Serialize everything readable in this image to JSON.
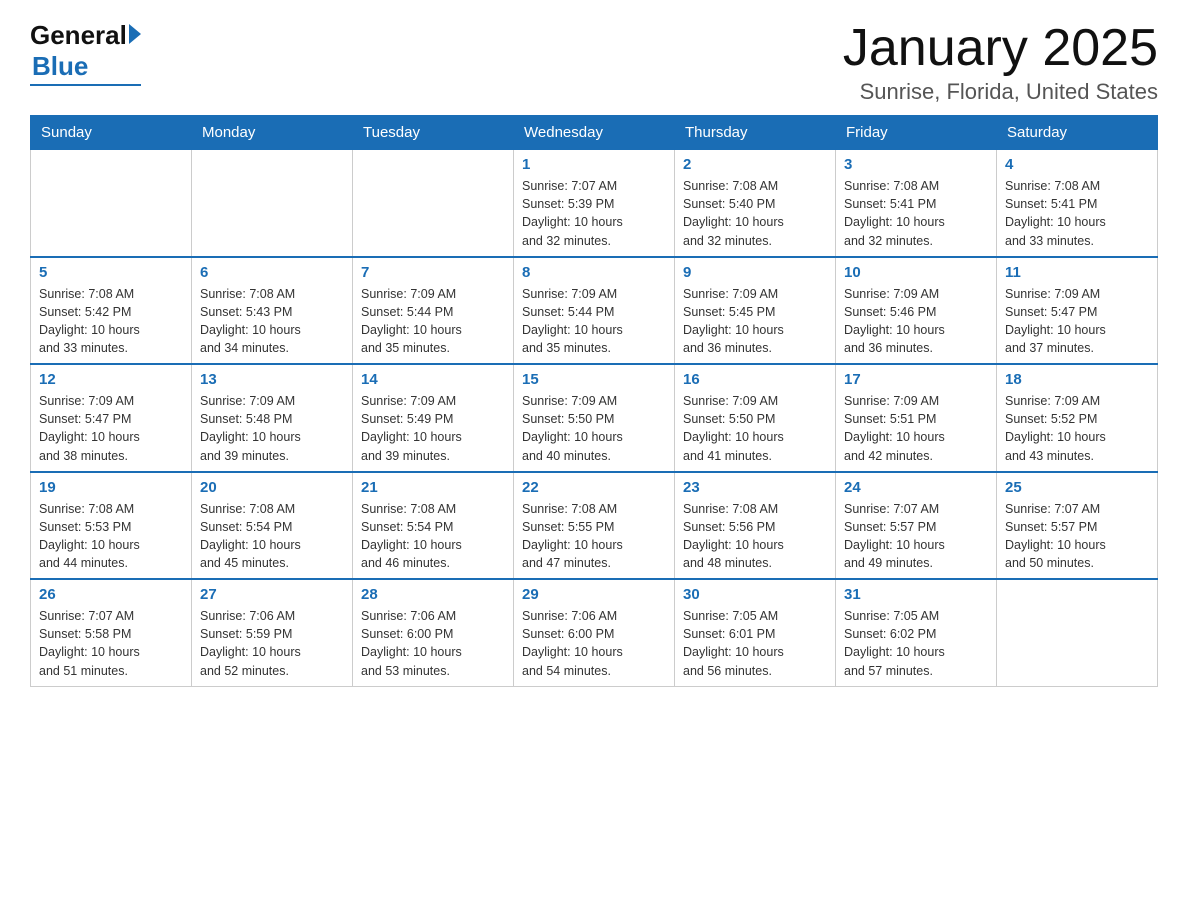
{
  "header": {
    "logo_general": "General",
    "logo_blue": "Blue",
    "title": "January 2025",
    "location": "Sunrise, Florida, United States"
  },
  "days_of_week": [
    "Sunday",
    "Monday",
    "Tuesday",
    "Wednesday",
    "Thursday",
    "Friday",
    "Saturday"
  ],
  "weeks": [
    {
      "days": [
        {
          "number": "",
          "info": ""
        },
        {
          "number": "",
          "info": ""
        },
        {
          "number": "",
          "info": ""
        },
        {
          "number": "1",
          "info": "Sunrise: 7:07 AM\nSunset: 5:39 PM\nDaylight: 10 hours\nand 32 minutes."
        },
        {
          "number": "2",
          "info": "Sunrise: 7:08 AM\nSunset: 5:40 PM\nDaylight: 10 hours\nand 32 minutes."
        },
        {
          "number": "3",
          "info": "Sunrise: 7:08 AM\nSunset: 5:41 PM\nDaylight: 10 hours\nand 32 minutes."
        },
        {
          "number": "4",
          "info": "Sunrise: 7:08 AM\nSunset: 5:41 PM\nDaylight: 10 hours\nand 33 minutes."
        }
      ]
    },
    {
      "days": [
        {
          "number": "5",
          "info": "Sunrise: 7:08 AM\nSunset: 5:42 PM\nDaylight: 10 hours\nand 33 minutes."
        },
        {
          "number": "6",
          "info": "Sunrise: 7:08 AM\nSunset: 5:43 PM\nDaylight: 10 hours\nand 34 minutes."
        },
        {
          "number": "7",
          "info": "Sunrise: 7:09 AM\nSunset: 5:44 PM\nDaylight: 10 hours\nand 35 minutes."
        },
        {
          "number": "8",
          "info": "Sunrise: 7:09 AM\nSunset: 5:44 PM\nDaylight: 10 hours\nand 35 minutes."
        },
        {
          "number": "9",
          "info": "Sunrise: 7:09 AM\nSunset: 5:45 PM\nDaylight: 10 hours\nand 36 minutes."
        },
        {
          "number": "10",
          "info": "Sunrise: 7:09 AM\nSunset: 5:46 PM\nDaylight: 10 hours\nand 36 minutes."
        },
        {
          "number": "11",
          "info": "Sunrise: 7:09 AM\nSunset: 5:47 PM\nDaylight: 10 hours\nand 37 minutes."
        }
      ]
    },
    {
      "days": [
        {
          "number": "12",
          "info": "Sunrise: 7:09 AM\nSunset: 5:47 PM\nDaylight: 10 hours\nand 38 minutes."
        },
        {
          "number": "13",
          "info": "Sunrise: 7:09 AM\nSunset: 5:48 PM\nDaylight: 10 hours\nand 39 minutes."
        },
        {
          "number": "14",
          "info": "Sunrise: 7:09 AM\nSunset: 5:49 PM\nDaylight: 10 hours\nand 39 minutes."
        },
        {
          "number": "15",
          "info": "Sunrise: 7:09 AM\nSunset: 5:50 PM\nDaylight: 10 hours\nand 40 minutes."
        },
        {
          "number": "16",
          "info": "Sunrise: 7:09 AM\nSunset: 5:50 PM\nDaylight: 10 hours\nand 41 minutes."
        },
        {
          "number": "17",
          "info": "Sunrise: 7:09 AM\nSunset: 5:51 PM\nDaylight: 10 hours\nand 42 minutes."
        },
        {
          "number": "18",
          "info": "Sunrise: 7:09 AM\nSunset: 5:52 PM\nDaylight: 10 hours\nand 43 minutes."
        }
      ]
    },
    {
      "days": [
        {
          "number": "19",
          "info": "Sunrise: 7:08 AM\nSunset: 5:53 PM\nDaylight: 10 hours\nand 44 minutes."
        },
        {
          "number": "20",
          "info": "Sunrise: 7:08 AM\nSunset: 5:54 PM\nDaylight: 10 hours\nand 45 minutes."
        },
        {
          "number": "21",
          "info": "Sunrise: 7:08 AM\nSunset: 5:54 PM\nDaylight: 10 hours\nand 46 minutes."
        },
        {
          "number": "22",
          "info": "Sunrise: 7:08 AM\nSunset: 5:55 PM\nDaylight: 10 hours\nand 47 minutes."
        },
        {
          "number": "23",
          "info": "Sunrise: 7:08 AM\nSunset: 5:56 PM\nDaylight: 10 hours\nand 48 minutes."
        },
        {
          "number": "24",
          "info": "Sunrise: 7:07 AM\nSunset: 5:57 PM\nDaylight: 10 hours\nand 49 minutes."
        },
        {
          "number": "25",
          "info": "Sunrise: 7:07 AM\nSunset: 5:57 PM\nDaylight: 10 hours\nand 50 minutes."
        }
      ]
    },
    {
      "days": [
        {
          "number": "26",
          "info": "Sunrise: 7:07 AM\nSunset: 5:58 PM\nDaylight: 10 hours\nand 51 minutes."
        },
        {
          "number": "27",
          "info": "Sunrise: 7:06 AM\nSunset: 5:59 PM\nDaylight: 10 hours\nand 52 minutes."
        },
        {
          "number": "28",
          "info": "Sunrise: 7:06 AM\nSunset: 6:00 PM\nDaylight: 10 hours\nand 53 minutes."
        },
        {
          "number": "29",
          "info": "Sunrise: 7:06 AM\nSunset: 6:00 PM\nDaylight: 10 hours\nand 54 minutes."
        },
        {
          "number": "30",
          "info": "Sunrise: 7:05 AM\nSunset: 6:01 PM\nDaylight: 10 hours\nand 56 minutes."
        },
        {
          "number": "31",
          "info": "Sunrise: 7:05 AM\nSunset: 6:02 PM\nDaylight: 10 hours\nand 57 minutes."
        },
        {
          "number": "",
          "info": ""
        }
      ]
    }
  ]
}
